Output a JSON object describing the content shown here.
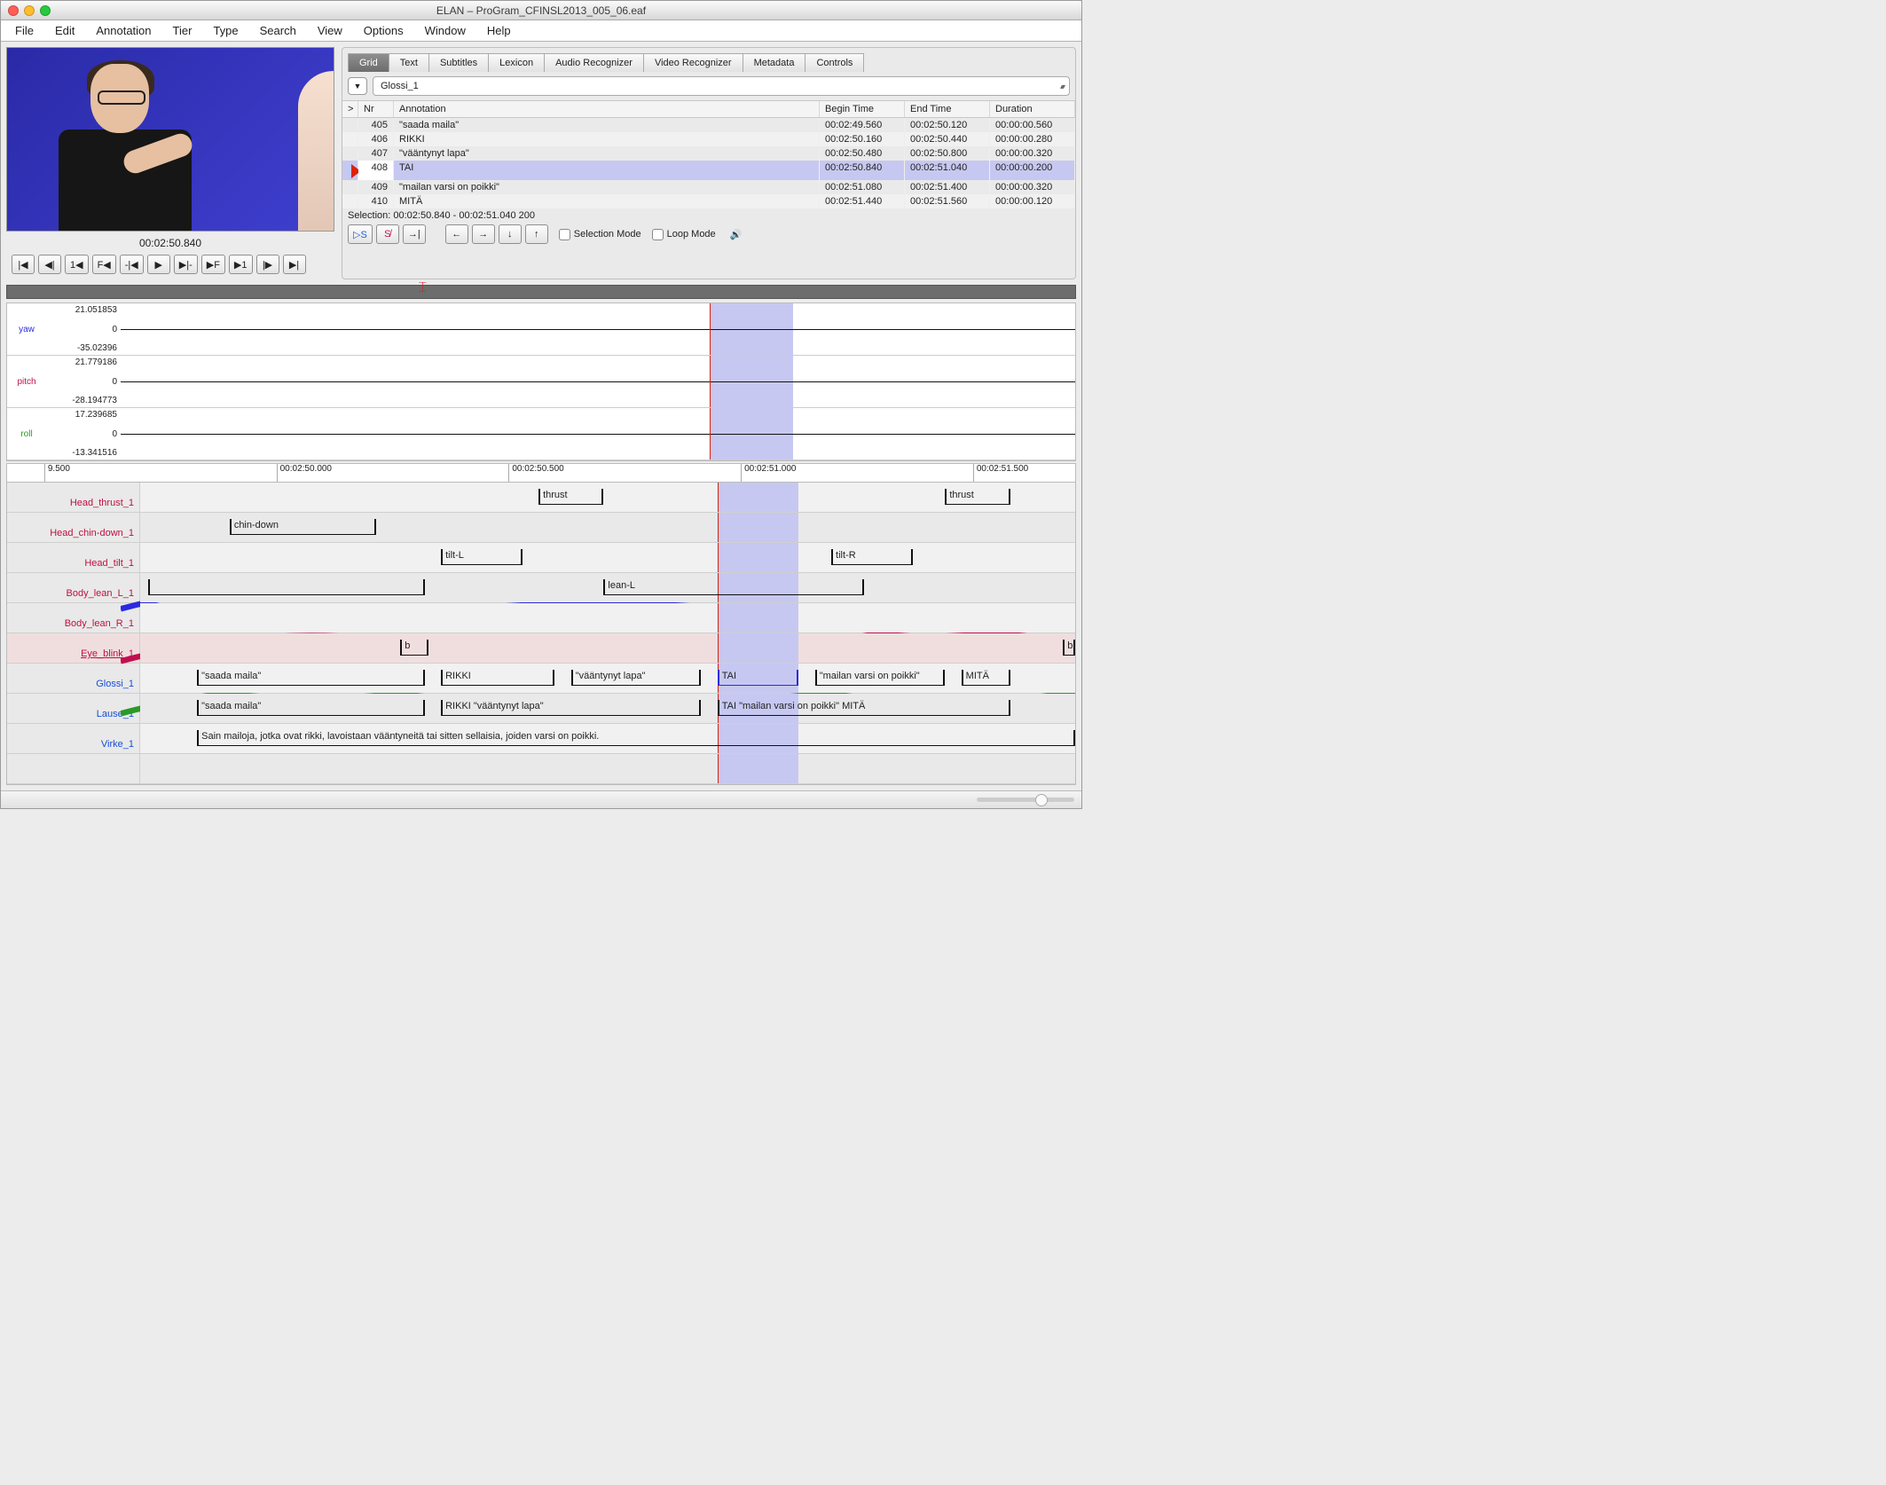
{
  "window_title": "ELAN – ProGram_CFINSL2013_005_06.eaf",
  "menu": [
    "File",
    "Edit",
    "Annotation",
    "Tier",
    "Type",
    "Search",
    "View",
    "Options",
    "Window",
    "Help"
  ],
  "video_time": "00:02:50.840",
  "tabs": [
    "Grid",
    "Text",
    "Subtitles",
    "Lexicon",
    "Audio Recognizer",
    "Video Recognizer",
    "Metadata",
    "Controls"
  ],
  "active_tab": "Grid",
  "tier_selected": "Glossi_1",
  "grid_headers": {
    "nr": "Nr",
    "ann": "Annotation",
    "begin": "Begin Time",
    "end": "End Time",
    "dur": "Duration",
    "gt": ">"
  },
  "grid_rows": [
    {
      "nr": 405,
      "ann": "\"saada maila\"",
      "begin": "00:02:49.560",
      "end": "00:02:50.120",
      "dur": "00:00:00.560"
    },
    {
      "nr": 406,
      "ann": "RIKKI",
      "begin": "00:02:50.160",
      "end": "00:02:50.440",
      "dur": "00:00:00.280"
    },
    {
      "nr": 407,
      "ann": "\"vääntynyt lapa\"",
      "begin": "00:02:50.480",
      "end": "00:02:50.800",
      "dur": "00:00:00.320"
    },
    {
      "nr": 408,
      "ann": "TAI",
      "begin": "00:02:50.840",
      "end": "00:02:51.040",
      "dur": "00:00:00.200",
      "selected": true
    },
    {
      "nr": 409,
      "ann": "\"mailan varsi on poikki\"",
      "begin": "00:02:51.080",
      "end": "00:02:51.400",
      "dur": "00:00:00.320"
    },
    {
      "nr": 410,
      "ann": "MITÄ",
      "begin": "00:02:51.440",
      "end": "00:02:51.560",
      "dur": "00:00:00.120"
    }
  ],
  "selection_text": "Selection: 00:02:50.840 - 00:02:51.040  200",
  "selection_mode_label": "Selection Mode",
  "loop_mode_label": "Loop Mode",
  "transport_labels": {
    "first": "|◀",
    "prevframe": "◀|",
    "oneback": "1◀",
    "fback": "F◀",
    "stepback": "-|◀",
    "play": "▶",
    "stepfwd": "▶|-",
    "ffwd": "▶F",
    "onefwd": "▶1",
    "nextframe": "|▶",
    "last": "▶|",
    "ds": "▷S",
    "scross": "S̸",
    "goto": "→|",
    "left": "←",
    "right": "→",
    "down": "↓",
    "up": "↑"
  },
  "signals": [
    {
      "name": "yaw",
      "max": "21.051853",
      "zero": "0",
      "min": "-35.02396",
      "color": "#2a2ae0"
    },
    {
      "name": "pitch",
      "max": "21.779186",
      "zero": "0",
      "min": "-28.194773",
      "color": "#c01050"
    },
    {
      "name": "roll",
      "max": "17.239685",
      "zero": "0",
      "min": "-13.341516",
      "color": "#2a9a2a"
    }
  ],
  "timeline": {
    "visible_start": 49.42,
    "visible_end": 51.72,
    "selection_start": 50.84,
    "selection_end": 51.04,
    "ticks": [
      {
        "t": 49.5,
        "label": "9.500"
      },
      {
        "t": 50.0,
        "label": "00:02:50.000"
      },
      {
        "t": 50.5,
        "label": "00:02:50.500"
      },
      {
        "t": 51.0,
        "label": "00:02:51.000"
      },
      {
        "t": 51.5,
        "label": "00:02:51.500"
      }
    ]
  },
  "tiers": [
    {
      "name": "Head_thrust_1",
      "color": "red",
      "ann": [
        {
          "s": 50.4,
          "e": 50.56,
          "t": "thrust"
        },
        {
          "s": 51.4,
          "e": 51.56,
          "t": "thrust"
        }
      ]
    },
    {
      "name": "Head_chin-down_1",
      "color": "red",
      "ann": [
        {
          "s": 49.64,
          "e": 50.0,
          "t": "chin-down"
        }
      ]
    },
    {
      "name": "Head_tilt_1",
      "color": "red",
      "ann": [
        {
          "s": 50.16,
          "e": 50.36,
          "t": "tilt-L"
        },
        {
          "s": 51.12,
          "e": 51.32,
          "t": "tilt-R"
        }
      ]
    },
    {
      "name": "Body_lean_L_1",
      "color": "red",
      "ann": [
        {
          "s": 49.44,
          "e": 50.12,
          "t": ""
        },
        {
          "s": 50.56,
          "e": 51.2,
          "t": "lean-L"
        }
      ]
    },
    {
      "name": "Body_lean_R_1",
      "color": "red",
      "ann": []
    },
    {
      "name": "Eye_blink_1",
      "color": "red",
      "under": true,
      "highlight": true,
      "ann": [
        {
          "s": 50.06,
          "e": 50.13,
          "t": "b"
        },
        {
          "s": 51.69,
          "e": 51.72,
          "t": "b"
        }
      ]
    },
    {
      "name": "Glossi_1",
      "color": "blue",
      "ann": [
        {
          "s": 49.56,
          "e": 50.12,
          "t": "\"saada maila\""
        },
        {
          "s": 50.16,
          "e": 50.44,
          "t": "RIKKI"
        },
        {
          "s": 50.48,
          "e": 50.8,
          "t": "\"vääntynyt lapa\""
        },
        {
          "s": 50.84,
          "e": 51.04,
          "t": "TAI",
          "sel": true
        },
        {
          "s": 51.08,
          "e": 51.4,
          "t": "\"mailan varsi on poikki\""
        },
        {
          "s": 51.44,
          "e": 51.56,
          "t": "MITÄ"
        }
      ]
    },
    {
      "name": "Lause_1",
      "color": "blue",
      "ann": [
        {
          "s": 49.56,
          "e": 50.12,
          "t": "\"saada maila\""
        },
        {
          "s": 50.16,
          "e": 50.8,
          "t": "RIKKI \"vääntynyt lapa\""
        },
        {
          "s": 50.84,
          "e": 51.56,
          "t": "TAI \"mailan varsi on poikki\" MITÄ"
        }
      ]
    },
    {
      "name": "Virke_1",
      "color": "blue",
      "ann": [
        {
          "s": 49.56,
          "e": 51.72,
          "t": "Sain mailoja, jotka ovat rikki, lavoistaan vääntyneitä tai sitten sellaisia, joiden varsi on poikki."
        }
      ]
    },
    {
      "name": "",
      "color": "blue",
      "ann": []
    }
  ]
}
